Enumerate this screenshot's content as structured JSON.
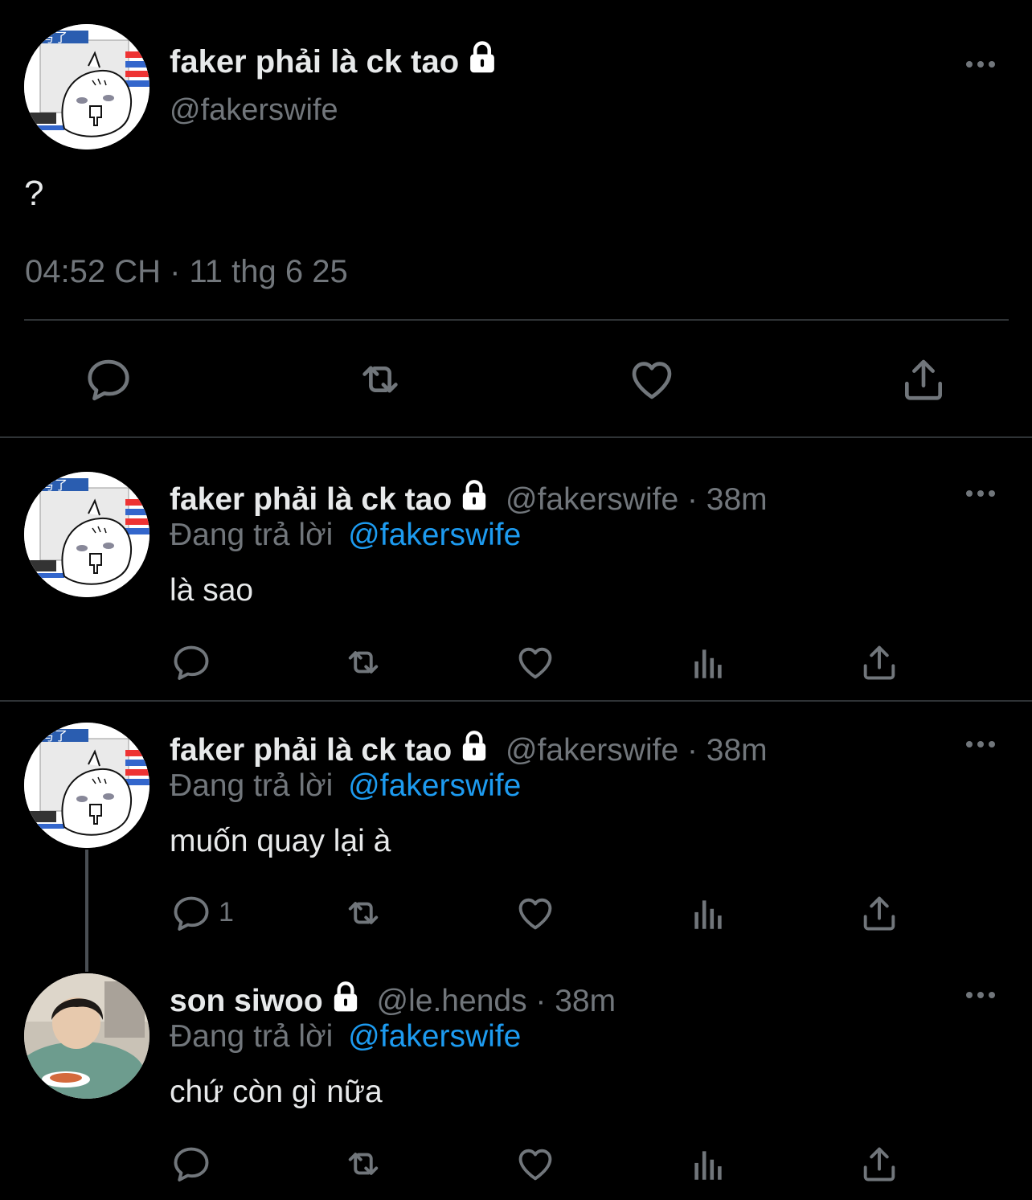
{
  "main_tweet": {
    "display_name": "faker phải là ck tao",
    "handle": "@fakerswife",
    "text": "?",
    "timestamp": "04:52 CH · 11 thg 6 25"
  },
  "replies": [
    {
      "display_name": "faker phải là ck tao",
      "meta": "@fakerswife · 38m",
      "replying_label": "Đang trả lời",
      "replying_to": "@fakerswife",
      "text": "là sao",
      "reply_count": ""
    },
    {
      "display_name": "faker phải là ck tao",
      "meta": "@fakerswife · 38m",
      "replying_label": "Đang trả lời",
      "replying_to": "@fakerswife",
      "text": "muốn quay lại à",
      "reply_count": "1"
    },
    {
      "display_name": "son siwoo",
      "meta": "@le.hends · 38m",
      "replying_label": "Đang trả lời",
      "replying_to": "@fakerswife",
      "text": "chứ còn gì nữa",
      "reply_count": ""
    }
  ],
  "icons": [
    "more-icon",
    "lock-icon",
    "reply-icon",
    "retweet-icon",
    "like-icon",
    "views-icon",
    "share-icon"
  ],
  "colors": {
    "background": "#000000",
    "text": "#e7e9ea",
    "muted": "#71767b",
    "link": "#1d9bf0",
    "divider": "#2f3336"
  }
}
